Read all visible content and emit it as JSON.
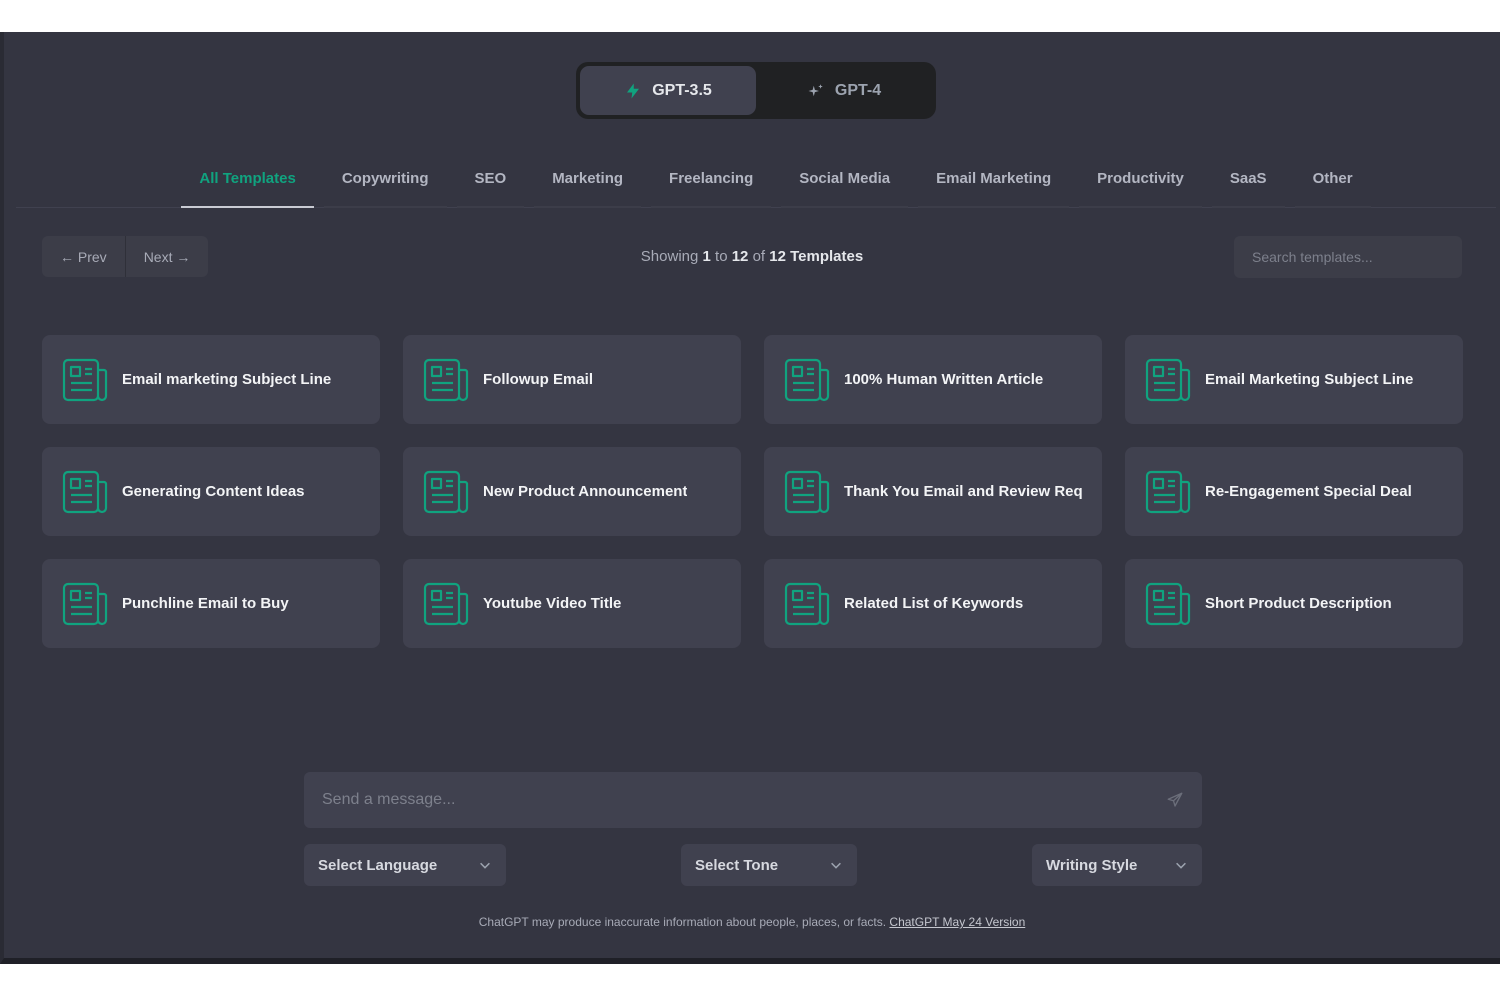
{
  "models": {
    "gpt35_label": "GPT-3.5",
    "gpt4_label": "GPT-4"
  },
  "tabs": [
    {
      "label": "All Templates"
    },
    {
      "label": "Copywriting"
    },
    {
      "label": "SEO"
    },
    {
      "label": "Marketing"
    },
    {
      "label": "Freelancing"
    },
    {
      "label": "Social Media"
    },
    {
      "label": "Email Marketing"
    },
    {
      "label": "Productivity"
    },
    {
      "label": "SaaS"
    },
    {
      "label": "Other"
    }
  ],
  "pager": {
    "prev_label": "← Prev",
    "next_label": "Next →"
  },
  "showing": {
    "prefix": "Showing",
    "from": "1",
    "to_word": "to",
    "to": "12",
    "of_word": "of",
    "total": "12 Templates"
  },
  "search": {
    "placeholder": "Search templates..."
  },
  "cards": [
    {
      "title": "Email marketing Subject Line"
    },
    {
      "title": "Followup Email"
    },
    {
      "title": "100% Human Written Article"
    },
    {
      "title": "Email Marketing Subject Line"
    },
    {
      "title": "Generating Content Ideas"
    },
    {
      "title": "New Product Announcement"
    },
    {
      "title": "Thank You Email and Review Req"
    },
    {
      "title": "Re-Engagement Special Deal"
    },
    {
      "title": "Punchline Email to Buy"
    },
    {
      "title": "Youtube Video Title"
    },
    {
      "title": "Related List of Keywords"
    },
    {
      "title": "Short Product Description"
    }
  ],
  "composer": {
    "placeholder": "Send a message..."
  },
  "selects": {
    "language": "Select Language",
    "tone": "Select Tone",
    "style": "Writing Style"
  },
  "footer": {
    "text": "ChatGPT may produce inaccurate information about people, places, or facts.",
    "link": "ChatGPT May 24 Version"
  },
  "colors": {
    "accent": "#10a37f",
    "background": "#343541",
    "card": "#40414f"
  }
}
